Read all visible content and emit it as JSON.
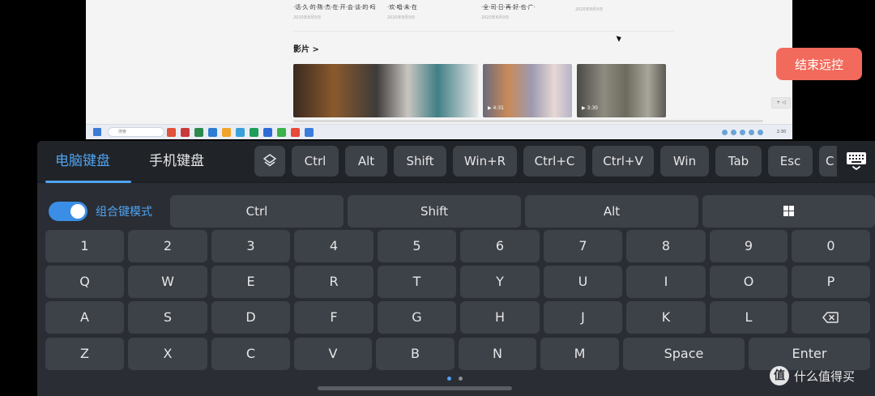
{
  "remote_desktop": {
    "news": [
      {
        "title": "·话·久·的·陈·杰·在·开·会·谈·的·吗",
        "date": "2020年8月9日"
      },
      {
        "title": "·欢·唱·未·在",
        "date": "2020年8月9日"
      },
      {
        "title": "·全·司·日·再·好·也·广·",
        "date": "2020年8月9日"
      },
      {
        "title": "",
        "date": "2020年8月9日"
      }
    ],
    "section_title": "影片 >",
    "video_durations": [
      "▶ 4:31",
      "▶ 3:30"
    ],
    "scroll_control": "+ ◁",
    "taskbar_search": "搜索",
    "clock": "2:30"
  },
  "end_remote_label": "结束远控",
  "tabs": {
    "pc": "电脑键盘",
    "phone": "手机键盘"
  },
  "quick_keys": {
    "ctrl": "Ctrl",
    "alt": "Alt",
    "shift": "Shift",
    "winr": "Win+R",
    "ctrlc": "Ctrl+C",
    "ctrlv": "Ctrl+V",
    "win": "Win",
    "tab": "Tab",
    "esc": "Esc",
    "partial": "C"
  },
  "combo_mode": {
    "label": "组合键模式",
    "enabled": true
  },
  "modifier_keys": {
    "ctrl": "Ctrl",
    "shift": "Shift",
    "alt": "Alt"
  },
  "keys": {
    "row1": [
      "1",
      "2",
      "3",
      "4",
      "5",
      "6",
      "7",
      "8",
      "9",
      "0"
    ],
    "row2": [
      "Q",
      "W",
      "E",
      "R",
      "T",
      "Y",
      "U",
      "I",
      "O",
      "P"
    ],
    "row3": [
      "A",
      "S",
      "D",
      "F",
      "G",
      "H",
      "J",
      "K",
      "L"
    ],
    "row4": [
      "Z",
      "X",
      "C",
      "V",
      "B",
      "N",
      "M"
    ],
    "space": "Space",
    "enter": "Enter"
  },
  "watermark": {
    "logo": "值",
    "text": "什么值得买"
  },
  "colors": {
    "accent": "#4fa3f0",
    "end_button": "#f26a5b",
    "panel": "#2a2d33",
    "key": "#3d4148"
  }
}
